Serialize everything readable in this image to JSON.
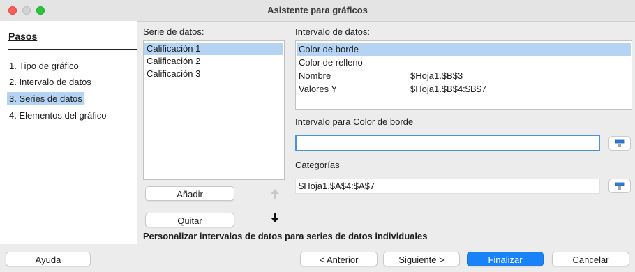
{
  "window": {
    "title": "Asistente para gráficos"
  },
  "steps": {
    "header": "Pasos",
    "items": [
      {
        "label": "1. Tipo de gráfico"
      },
      {
        "label": "2. Intervalo de datos"
      },
      {
        "label": "3. Series de datos",
        "selected": true
      },
      {
        "label": "4. Elementos del gráfico"
      }
    ]
  },
  "series": {
    "label": "Serie de datos:",
    "items": [
      "Calificación 1",
      "Calificación 2",
      "Calificación 3"
    ],
    "selected_index": 0,
    "add_label": "Añadir",
    "remove_label": "Quitar"
  },
  "ranges": {
    "label": "Intervalo de datos:",
    "rows": [
      {
        "name": "Color de borde",
        "value": ""
      },
      {
        "name": "Color de relleno",
        "value": ""
      },
      {
        "name": "Nombre",
        "value": "$Hoja1.$B$3"
      },
      {
        "name": "Valores Y",
        "value": "$Hoja1.$B$4:$B$7"
      }
    ],
    "range_for_label": "Intervalo para Color de borde",
    "range_for_value": "",
    "categories_label": "Categorías",
    "categories_value": "$Hoja1.$A$4:$A$7"
  },
  "hint": "Personalizar intervalos de datos para series de datos individuales",
  "footer": {
    "help": "Ayuda",
    "back": "< Anterior",
    "next": "Siguiente >",
    "finish": "Finalizar",
    "cancel": "Cancelar"
  },
  "colors": {
    "accent": "#1a82f7",
    "selection": "#b5d4f4"
  }
}
